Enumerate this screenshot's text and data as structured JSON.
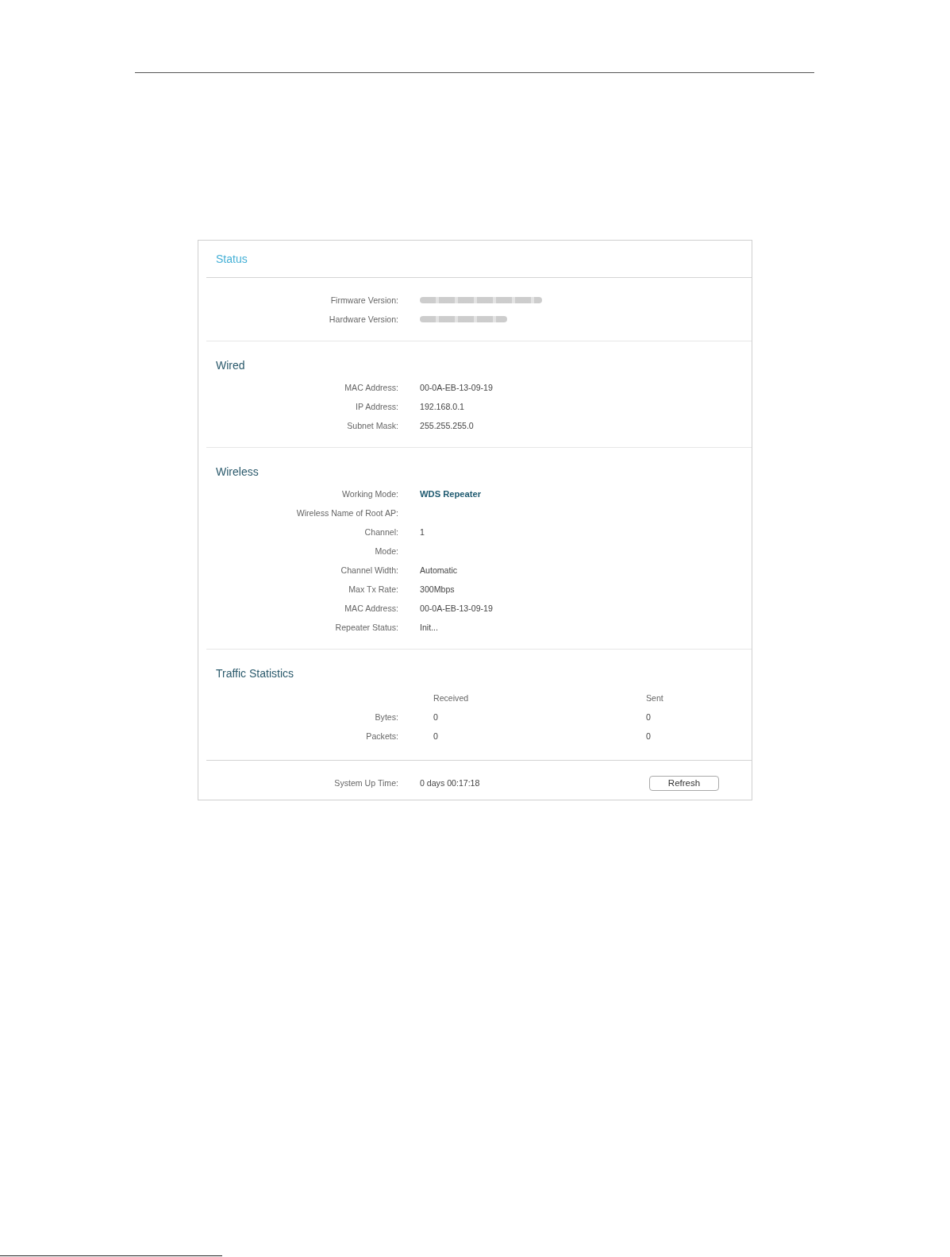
{
  "panel": {
    "title": "Status"
  },
  "sections": [
    {
      "kind": "fields",
      "rows": [
        {
          "label": "Firmware Version:",
          "kind": "blurred"
        },
        {
          "label": "Hardware Version:",
          "kind": "blurred"
        }
      ]
    },
    {
      "kind": "fields",
      "title": "Wired",
      "rows": [
        {
          "label": "MAC Address:",
          "value": "00-0A-EB-13-09-19",
          "kind": "plain"
        },
        {
          "label": "IP Address:",
          "value": "192.168.0.1",
          "kind": "plain"
        },
        {
          "label": "Subnet Mask:",
          "value": "255.255.255.0",
          "kind": "plain"
        }
      ]
    },
    {
      "kind": "fields",
      "title": "Wireless",
      "rows": [
        {
          "label": "Working Mode:",
          "value": "WDS Repeater",
          "kind": "bold"
        },
        {
          "label": "Wireless Name of Root AP:",
          "kind": "plain"
        },
        {
          "label": "Channel:",
          "value": "1",
          "kind": "plain"
        },
        {
          "label": "Mode:",
          "kind": "plain"
        },
        {
          "label": "Channel Width:",
          "value": "Automatic",
          "kind": "plain"
        },
        {
          "label": "Max Tx Rate:",
          "value": "300Mbps",
          "kind": "plain"
        },
        {
          "label": "MAC Address:",
          "value": "00-0A-EB-13-09-19",
          "kind": "plain"
        },
        {
          "label": "Repeater Status:",
          "value": "Init...",
          "kind": "plain"
        }
      ]
    },
    {
      "kind": "traffic",
      "title": "Traffic Statistics",
      "columns": [
        "Received",
        "Sent"
      ],
      "rows": [
        {
          "label": "Bytes:",
          "cells": [
            "0",
            "0"
          ]
        },
        {
          "label": "Packets:",
          "cells": [
            "0",
            "0"
          ]
        }
      ]
    },
    {
      "kind": "footer",
      "label": "System Up Time:",
      "value": "0 days 00:17:18",
      "button": "Refresh"
    }
  ]
}
